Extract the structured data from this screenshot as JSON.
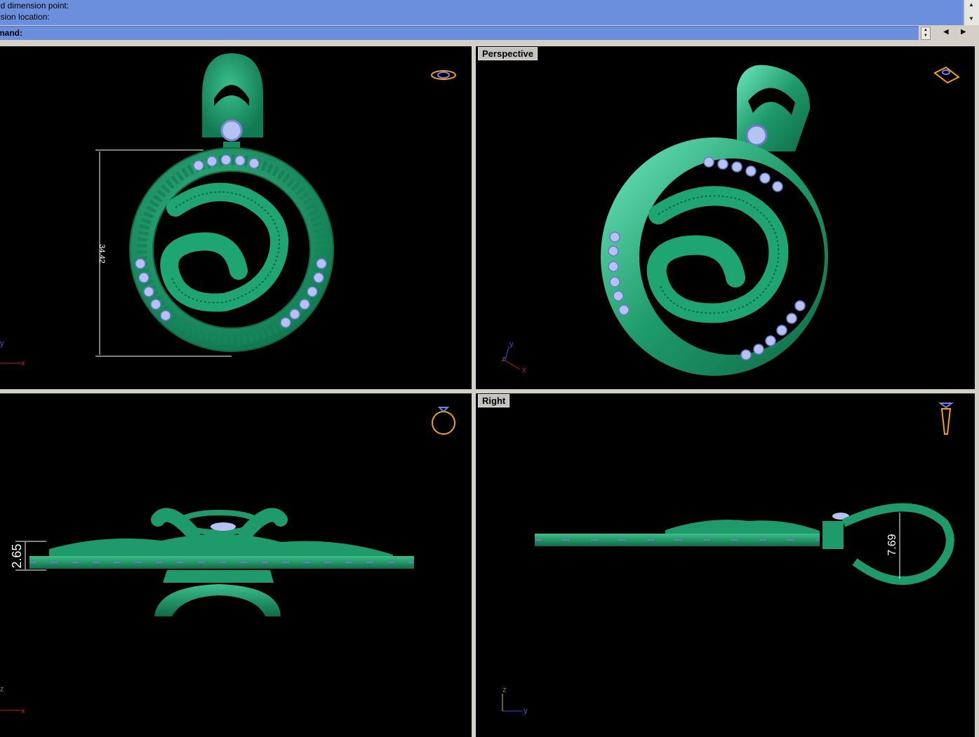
{
  "command_history": {
    "lines": [
      "nd dimension point:",
      "nsion location:"
    ]
  },
  "command_prompt": {
    "label": "mand:",
    "value": ""
  },
  "viewports": {
    "top_left": {
      "title": "",
      "dimension": "34.42",
      "axis_labels": [
        "y",
        "x"
      ]
    },
    "top_right": {
      "title": "Perspective",
      "axis_labels": [
        "y",
        "z",
        "x"
      ]
    },
    "bottom_left": {
      "title": "",
      "dimension": "2.65",
      "axis_labels": [
        "z",
        "x"
      ]
    },
    "bottom_right": {
      "title": "Right",
      "dimension": "7.69",
      "axis_labels": [
        "z",
        "y"
      ]
    }
  },
  "icons": {
    "top_left": "ring-top-view-icon",
    "top_right": "ring-perspective-icon",
    "bottom_left": "ring-front-view-icon",
    "bottom_right": "ring-side-view-icon"
  },
  "colors": {
    "command_bar": "#6b8fdc",
    "viewport_bg": "#000000",
    "model_green": "#1f9a6a",
    "gem": "#b6c2f4",
    "dimension_line": "#ffffff",
    "nav_icon": "#f0a020"
  }
}
